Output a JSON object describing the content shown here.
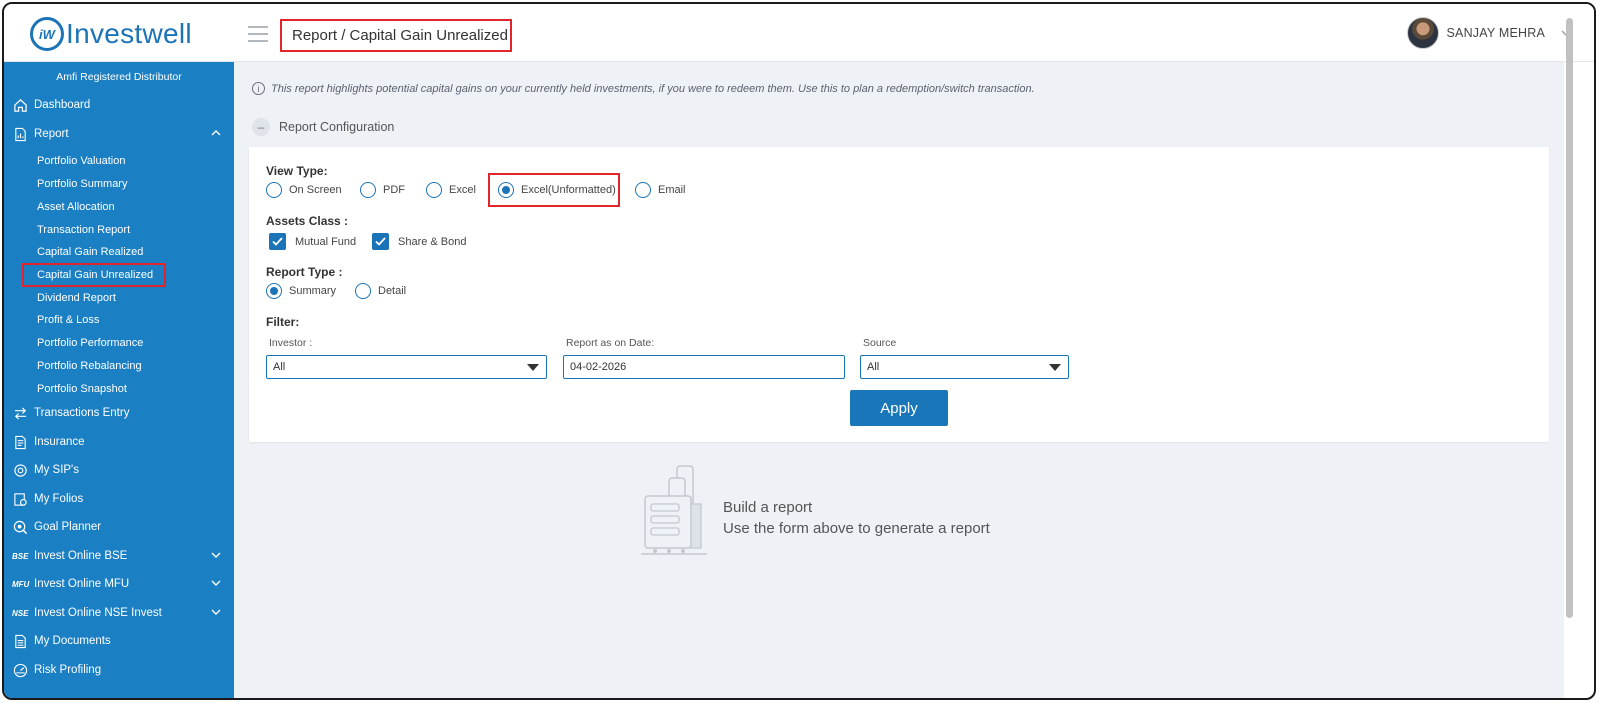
{
  "brand": {
    "name": "Investwell",
    "mark": "iW",
    "color": "#1b73b8"
  },
  "header": {
    "breadcrumb": "Report / Capital Gain Unrealized",
    "user_name": "SANJAY MEHRA"
  },
  "sidebar": {
    "title": "Amfi Registered Distributor",
    "items": [
      {
        "label": "Dashboard",
        "icon": "home-icon"
      },
      {
        "label": "Report",
        "icon": "report-icon",
        "expanded": true
      },
      {
        "label": "Transactions Entry",
        "icon": "swap-arrows-icon"
      },
      {
        "label": "Insurance",
        "icon": "insurance-doc-icon"
      },
      {
        "label": "My SIP's",
        "icon": "sip-icon"
      },
      {
        "label": "My Folios",
        "icon": "folios-icon"
      },
      {
        "label": "Goal Planner",
        "icon": "goal-icon"
      },
      {
        "label": "Invest Online BSE",
        "icon": "bse-logo",
        "badge": "BSE"
      },
      {
        "label": "Invest Online MFU",
        "icon": "mfu-logo",
        "badge": "MFU"
      },
      {
        "label": "Invest Online NSE Invest",
        "icon": "nse-logo",
        "badge": "NSE"
      },
      {
        "label": "My Documents",
        "icon": "document-icon"
      },
      {
        "label": "Risk Profiling",
        "icon": "gauge-icon"
      }
    ],
    "report_subitems": [
      "Portfolio Valuation",
      "Portfolio Summary",
      "Asset Allocation",
      "Transaction Report",
      "Capital Gain Realized",
      "Capital Gain Unrealized",
      "Dividend Report",
      "Profit & Loss",
      "Portfolio Performance",
      "Portfolio Rebalancing",
      "Portfolio Snapshot"
    ],
    "active_subitem": "Capital Gain Unrealized",
    "bg_color": "#1a7fc3"
  },
  "main": {
    "info_text": "This report highlights potential capital gains on your currently held investments, if you were to redeem them. Use this to plan a redemption/switch transaction.",
    "config_title": "Report Configuration",
    "view_type": {
      "label": "View Type:",
      "options": [
        "On Screen",
        "PDF",
        "Excel",
        "Excel(Unformatted)",
        "Email"
      ],
      "selected": "Excel(Unformatted)"
    },
    "assets_class": {
      "label": "Assets Class :",
      "options": [
        "Mutual Fund",
        "Share & Bond"
      ],
      "checked": [
        "Mutual Fund",
        "Share & Bond"
      ]
    },
    "report_type": {
      "label": "Report Type :",
      "options": [
        "Summary",
        "Detail"
      ],
      "selected": "Summary"
    },
    "filter": {
      "label": "Filter:",
      "investor_label": "Investor :",
      "investor_value": "All",
      "date_label": "Report as on Date:",
      "date_value": "04-02-2026",
      "source_label": "Source",
      "source_value": "All"
    },
    "apply_label": "Apply",
    "empty_state": {
      "title": "Build a report",
      "subtitle": "Use the form above to generate a report"
    }
  },
  "highlight_color": "#e0262b"
}
